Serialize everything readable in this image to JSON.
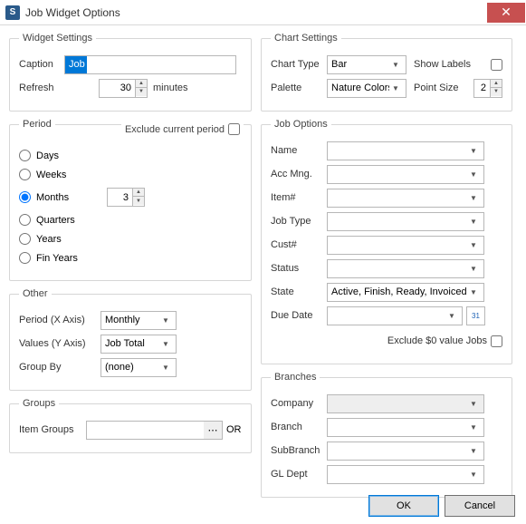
{
  "window": {
    "title": "Job Widget Options",
    "icon_letter": "S"
  },
  "widget_settings": {
    "legend": "Widget Settings",
    "caption_label": "Caption",
    "caption_value": "Job",
    "refresh_label": "Refresh",
    "refresh_value": "30",
    "refresh_unit": "minutes"
  },
  "period": {
    "legend": "Period",
    "exclude_label": "Exclude current period",
    "exclude_checked": false,
    "options": {
      "days": "Days",
      "weeks": "Weeks",
      "months": "Months",
      "quarters": "Quarters",
      "years": "Years",
      "fin_years": "Fin Years"
    },
    "selected": "months",
    "months_value": "3"
  },
  "other": {
    "legend": "Other",
    "period_x_label": "Period (X Axis)",
    "period_x_value": "Monthly",
    "values_y_label": "Values (Y Axis)",
    "values_y_value": "Job Total",
    "group_by_label": "Group By",
    "group_by_value": "(none)"
  },
  "groups": {
    "legend": "Groups",
    "item_groups_label": "Item Groups",
    "item_groups_value": "",
    "or_label": "OR"
  },
  "chart_settings": {
    "legend": "Chart Settings",
    "chart_type_label": "Chart Type",
    "chart_type_value": "Bar",
    "show_labels_label": "Show Labels",
    "show_labels_checked": false,
    "palette_label": "Palette",
    "palette_value": "Nature Colors",
    "point_size_label": "Point Size",
    "point_size_value": "2"
  },
  "job_options": {
    "legend": "Job Options",
    "name_label": "Name",
    "name_value": "",
    "acc_mng_label": "Acc Mng.",
    "acc_mng_value": "",
    "item_label": "Item#",
    "item_value": "",
    "job_type_label": "Job Type",
    "job_type_value": "",
    "cust_label": "Cust#",
    "cust_value": "",
    "status_label": "Status",
    "status_value": "",
    "state_label": "State",
    "state_value": "Active, Finish, Ready, Invoiced",
    "due_date_label": "Due Date",
    "due_date_value": "",
    "exclude_zero_label": "Exclude $0 value Jobs",
    "exclude_zero_checked": false
  },
  "branches": {
    "legend": "Branches",
    "company_label": "Company",
    "company_value": "",
    "branch_label": "Branch",
    "branch_value": "",
    "sub_branch_label": "SubBranch",
    "sub_branch_value": "",
    "gl_dept_label": "GL Dept",
    "gl_dept_value": ""
  },
  "footer": {
    "ok": "OK",
    "cancel": "Cancel"
  }
}
